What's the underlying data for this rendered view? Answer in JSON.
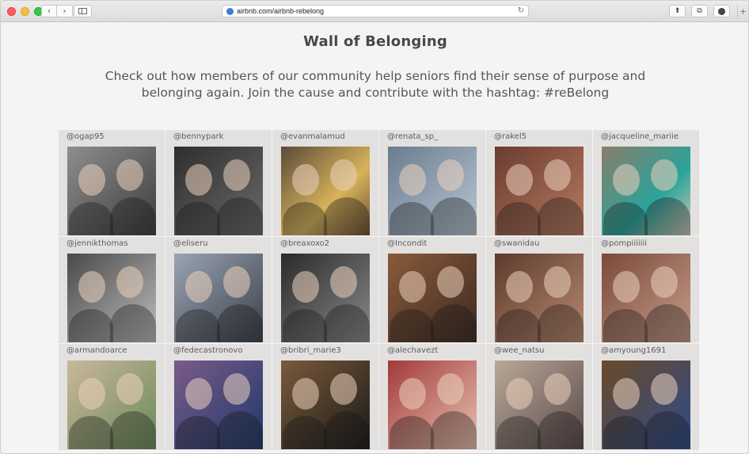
{
  "browser": {
    "url": "airbnb.com/airbnb-rebelong",
    "icons": {
      "back": "chevron-left-icon",
      "forward": "chevron-right-icon",
      "sidebar": "sidebar-icon",
      "reload": "reload-icon",
      "share": "share-icon",
      "tabs": "tabs-icon",
      "download": "download-icon",
      "new_tab": "plus-icon"
    }
  },
  "page": {
    "title": "Wall of Belonging",
    "subtitle": "Check out how members of our community help seniors find their sense of purpose and belonging again. Join the cause and contribute with the hashtag: #reBelong"
  },
  "wall": {
    "posts": [
      {
        "handle": "@ogap95"
      },
      {
        "handle": "@bennypark"
      },
      {
        "handle": "@evanmalamud"
      },
      {
        "handle": "@renata_sp_"
      },
      {
        "handle": "@rakel5"
      },
      {
        "handle": "@jacqueline_mariie"
      },
      {
        "handle": "@jennikthomas"
      },
      {
        "handle": "@eliseru"
      },
      {
        "handle": "@breaxoxo2"
      },
      {
        "handle": "@Incondit"
      },
      {
        "handle": "@swanidau"
      },
      {
        "handle": "@pompiiiiiii"
      },
      {
        "handle": "@armandoarce"
      },
      {
        "handle": "@fedecastronovo"
      },
      {
        "handle": "@bribri_marie3"
      },
      {
        "handle": "@alechavezt"
      },
      {
        "handle": "@wee_natsu"
      },
      {
        "handle": "@amyoung1691"
      }
    ]
  }
}
